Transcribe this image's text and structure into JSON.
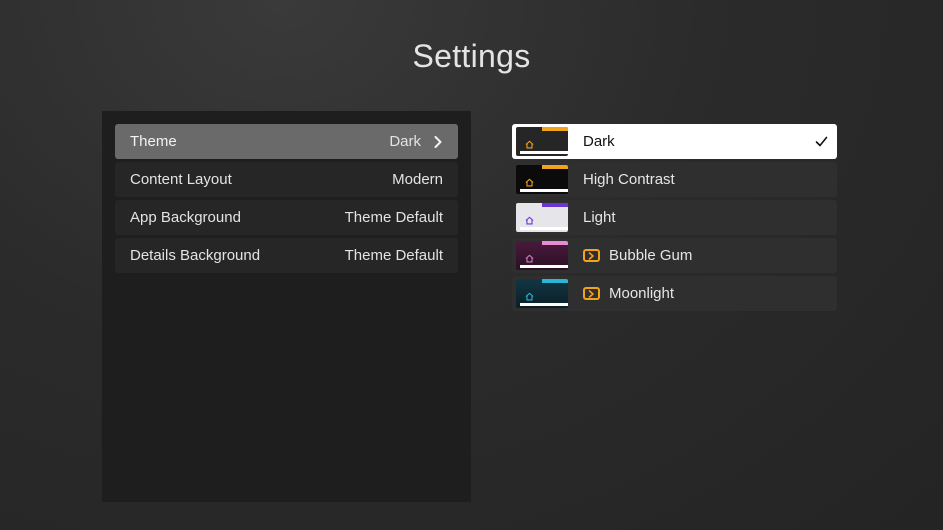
{
  "header": {
    "title": "Settings"
  },
  "settings": {
    "rows": [
      {
        "label": "Theme",
        "value": "Dark",
        "selected": true
      },
      {
        "label": "Content Layout",
        "value": "Modern"
      },
      {
        "label": "App Background",
        "value": "Theme Default"
      },
      {
        "label": "Details Background",
        "value": "Theme Default"
      }
    ]
  },
  "themes": {
    "options": [
      {
        "label": "Dark",
        "active": true,
        "premium": false,
        "thumb_bg": "#262626",
        "accent": "#f0a31b",
        "house": "#f0a31b",
        "icon": "check-icon"
      },
      {
        "label": "High Contrast",
        "active": false,
        "premium": false,
        "thumb_bg": "#0b0b0b",
        "accent": "#f0a31b",
        "house": "#f0a31b"
      },
      {
        "label": "Light",
        "active": false,
        "premium": false,
        "thumb_bg": "#e6e6ea",
        "accent": "#6a35d6",
        "house": "#6a35d6"
      },
      {
        "label": "Bubble Gum",
        "active": false,
        "premium": true,
        "thumb_bg": "#3a1530",
        "accent": "#e98ad4",
        "house": "#d07ac0",
        "badge_icon": "chevron-badge-icon"
      },
      {
        "label": "Moonlight",
        "active": false,
        "premium": true,
        "thumb_bg": "#0e2a35",
        "accent": "#2bb5d6",
        "house": "#2bb5d6",
        "badge_icon": "chevron-badge-icon"
      }
    ]
  },
  "colors": {
    "accent_orange": "#f0a31b",
    "selected_row": "#6a6a6a",
    "panel": "#1e1e1e"
  }
}
